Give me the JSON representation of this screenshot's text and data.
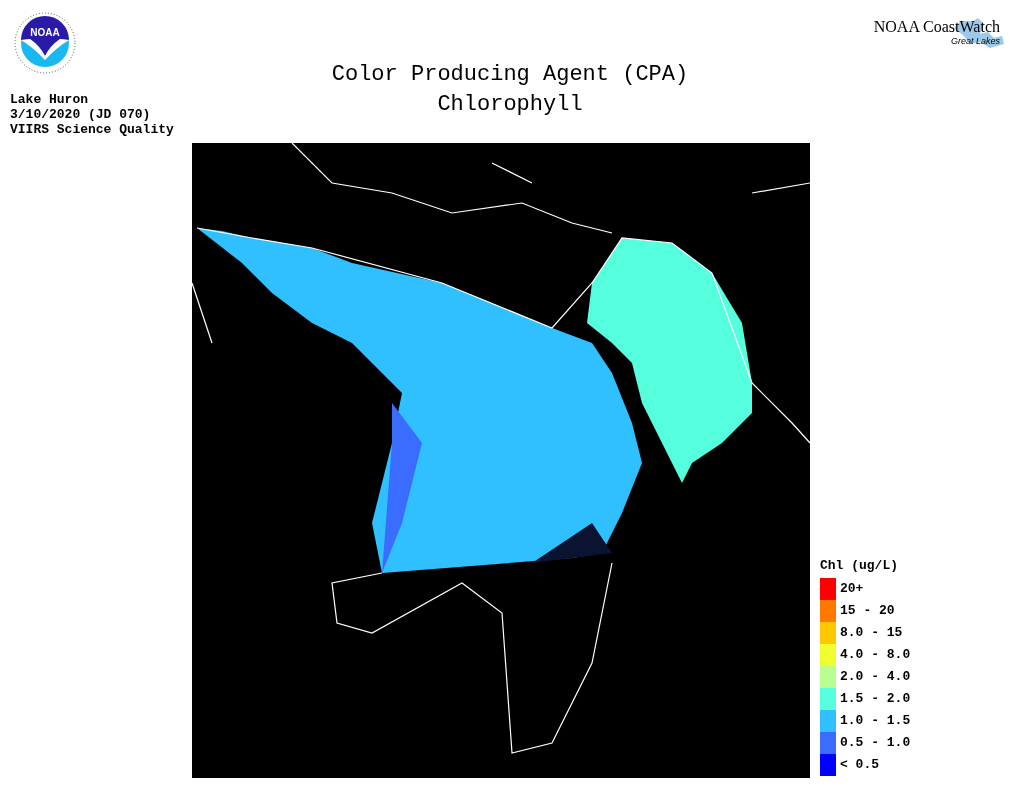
{
  "logo": {
    "text": "NOAA"
  },
  "brand": {
    "name": "NOAA CoastWatch",
    "subtitle": "Great Lakes"
  },
  "title": [
    "Color Producing Agent (CPA)",
    "Chlorophyll"
  ],
  "info": [
    "Lake Huron",
    "3/10/2020 (JD 070)",
    "VIIRS Science Quality"
  ],
  "legend": {
    "title": "Chl (ug/L)",
    "items": [
      {
        "label": "20+",
        "color": "#ff0000"
      },
      {
        "label": "15 - 20",
        "color": "#ff7800"
      },
      {
        "label": "8.0 - 15",
        "color": "#ffc800"
      },
      {
        "label": "4.0 - 8.0",
        "color": "#f0ff30"
      },
      {
        "label": "2.0 - 4.0",
        "color": "#b8ff90"
      },
      {
        "label": "1.5 - 2.0",
        "color": "#55ffdd"
      },
      {
        "label": "1.0 - 1.5",
        "color": "#30c0ff"
      },
      {
        "label": "0.5 - 1.0",
        "color": "#3a6cff"
      },
      {
        "label": "< 0.5",
        "color": "#0000ff"
      }
    ]
  }
}
